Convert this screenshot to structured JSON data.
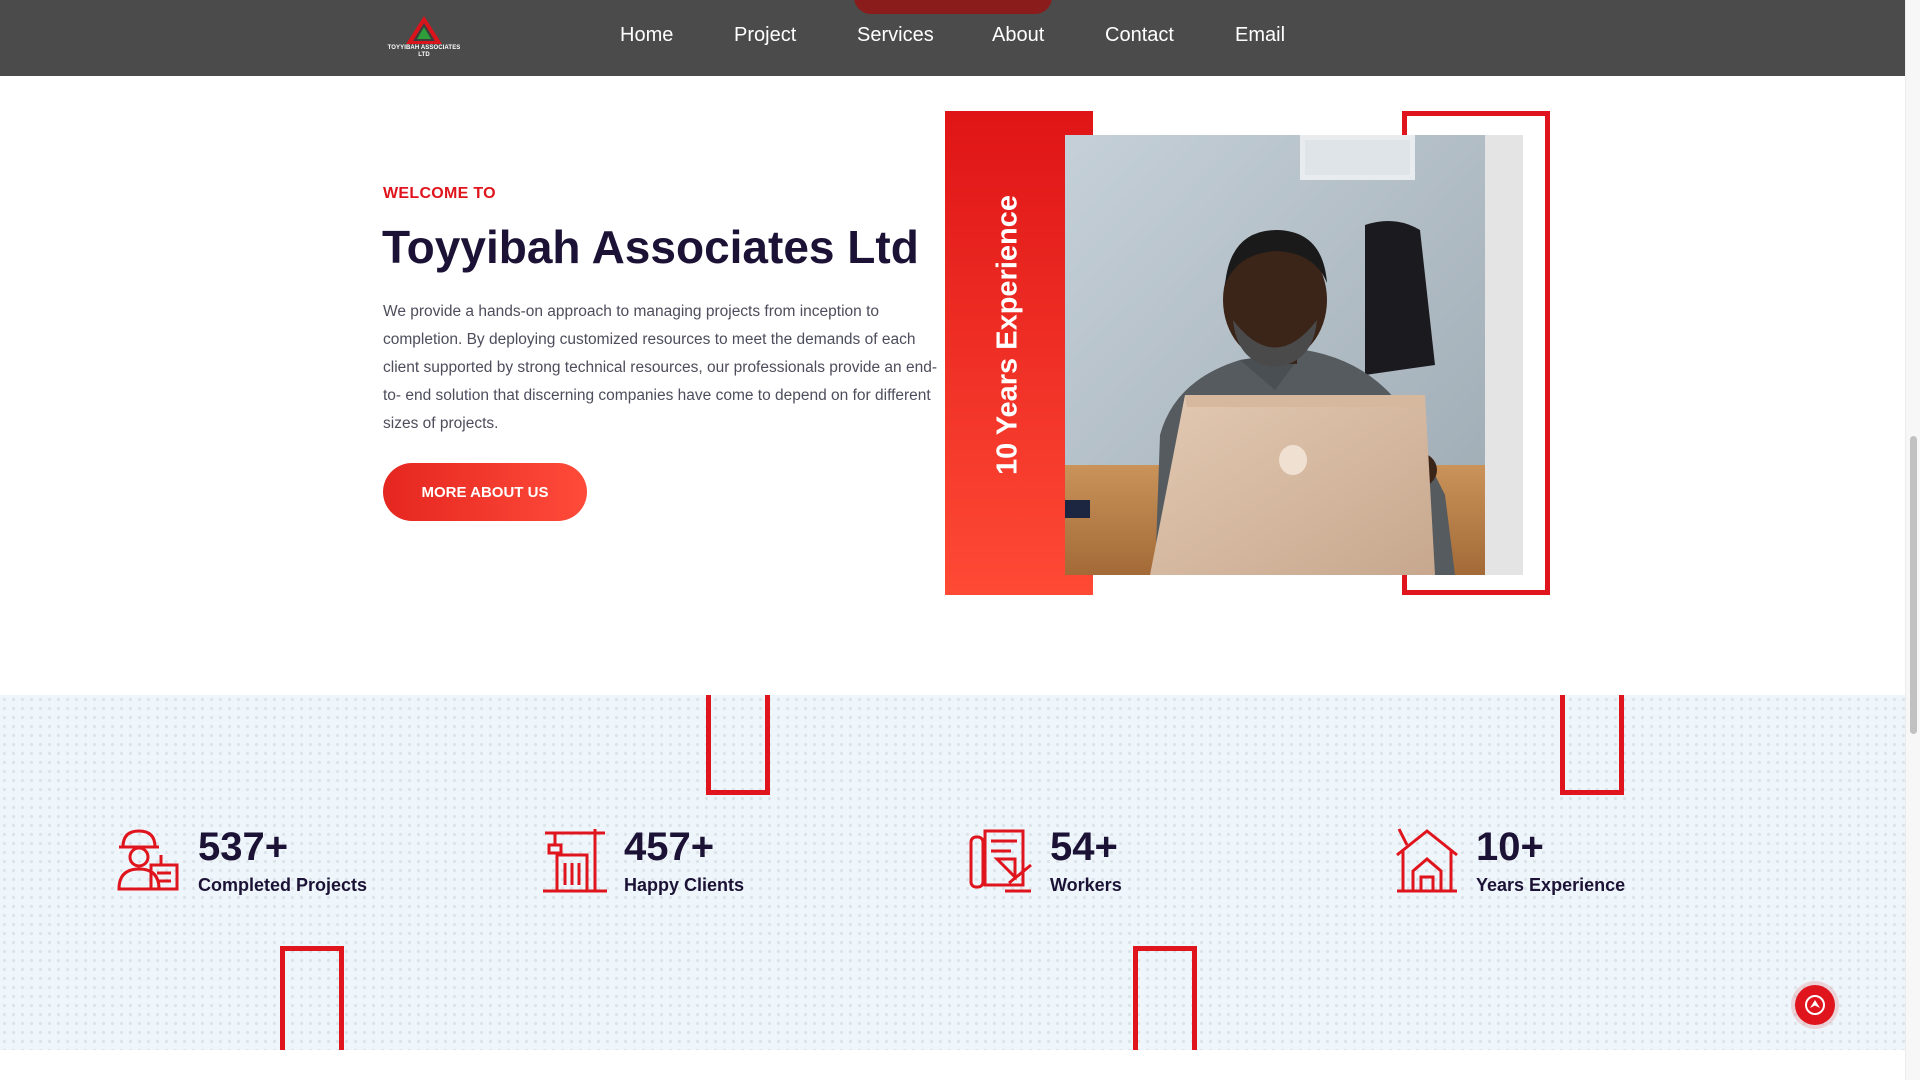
{
  "nav": {
    "logo_text": "TOYYIBAH ASSOCIATES LTD",
    "links": [
      "Home",
      "Project",
      "Services",
      "About",
      "Contact",
      "Email"
    ]
  },
  "hero": {
    "welcome": "WELCOME TO",
    "title": "Toyyibah Associates Ltd",
    "description": "We provide a hands-on approach to managing projects from inception to completion. By deploying customized resources to meet the demands of each client supported by strong technical resources, our professionals provide an end-to- end solution that discerning companies have come to depend on for different sizes of projects.",
    "button": "MORE ABOUT US",
    "experience_label": "10 Years Experience"
  },
  "stats": [
    {
      "number": "537+",
      "label": "Completed Projects",
      "icon": "engineer-icon"
    },
    {
      "number": "457+",
      "label": "Happy Clients",
      "icon": "crane-building-icon"
    },
    {
      "number": "54+",
      "label": "Workers",
      "icon": "blueprint-tools-icon"
    },
    {
      "number": "10+",
      "label": "Years Experience",
      "icon": "house-construction-icon"
    }
  ],
  "colors": {
    "accent": "#e0141c",
    "navbar": "#4b4b4b",
    "heading": "#1b1235",
    "stats_bg": "#eef6fb"
  }
}
